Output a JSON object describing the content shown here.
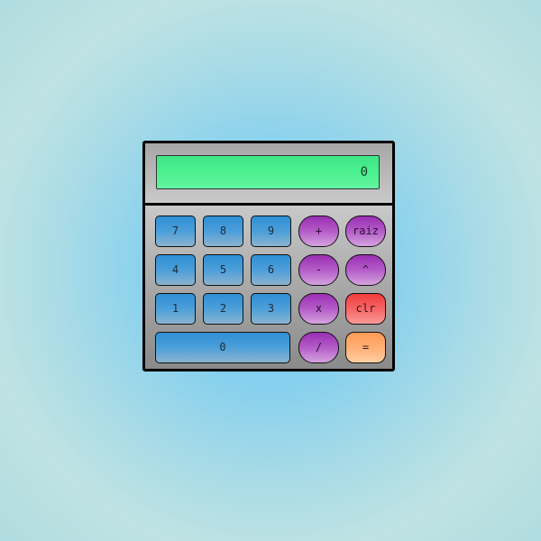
{
  "display": {
    "value": "0"
  },
  "keys": {
    "seven": "7",
    "eight": "8",
    "nine": "9",
    "plus": "+",
    "sqrt": "raiz",
    "four": "4",
    "five": "5",
    "six": "6",
    "minus": "-",
    "power": "^",
    "one": "1",
    "two": "2",
    "three": "3",
    "multiply": "x",
    "clear": "clr",
    "zero": "0",
    "divide": "/",
    "equals": "="
  },
  "colors": {
    "display_green": "#4cf08f",
    "number_key_blue": "#4c9fd9",
    "operator_key_purple": "#b45cc8",
    "clear_key_red": "#f66a6a",
    "equals_key_orange": "#ffb27a"
  }
}
